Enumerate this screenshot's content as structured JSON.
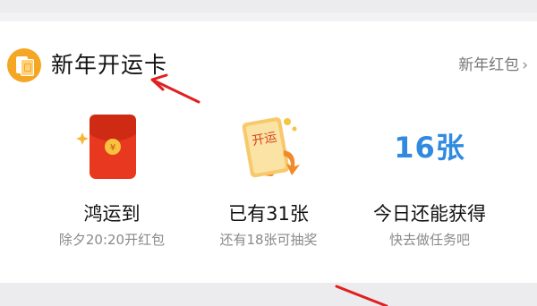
{
  "header": {
    "title": "新年开运卡",
    "more_link": "新年红包",
    "chevron": "›"
  },
  "columns": [
    {
      "icon": "red-envelope-icon",
      "label": "鸿运到",
      "sub": "除夕20:20开红包"
    },
    {
      "icon": "lucky-card-icon",
      "card_text": "开运",
      "label": "已有31张",
      "sub": "还有18张可抽奖"
    },
    {
      "count": "16张",
      "label": "今日还能获得",
      "sub": "快去做任务吧"
    }
  ],
  "colors": {
    "accent_orange": "#f5a623",
    "envelope_red": "#e8381f",
    "count_blue": "#2f8ae0",
    "annotation_red": "#e02020"
  }
}
